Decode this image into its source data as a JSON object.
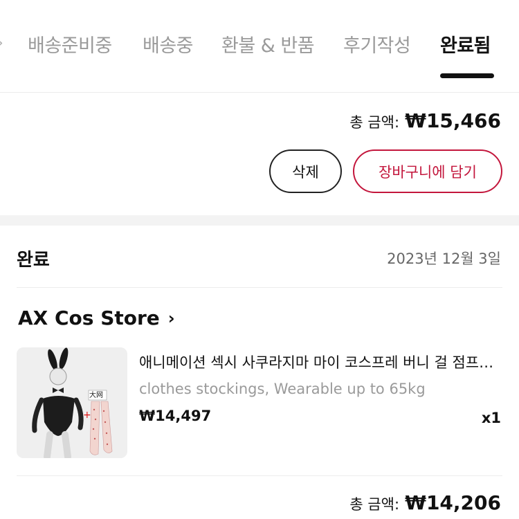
{
  "tabs": [
    {
      "label": "배송준비중",
      "active": false
    },
    {
      "label": "배송중",
      "active": false
    },
    {
      "label": "환불 & 반품",
      "active": false
    },
    {
      "label": "후기작성",
      "active": false
    },
    {
      "label": "완료됨",
      "active": true
    }
  ],
  "summary": {
    "total_label": "총 금액:",
    "total_value": "₩15,466",
    "delete_label": "삭제",
    "cart_label": "장바구니에 담기"
  },
  "order": {
    "status": "완료",
    "date": "2023년 12월 3일",
    "store_name": "AX Cos Store",
    "product": {
      "name": "애니메이션 섹시 사쿠라지마 마이 코스프레 버니 걸 점프수트",
      "option": "clothes stockings, Wearable up to 65kg",
      "price": "₩14,497",
      "quantity": "x1",
      "image_text": "大网"
    },
    "total_label": "총 금액:",
    "total_value": "₩14,206"
  },
  "colors": {
    "accent": "#c3163c",
    "muted": "#9a9a9a",
    "divider": "#ececec",
    "section_gap": "#f3f3f3"
  }
}
